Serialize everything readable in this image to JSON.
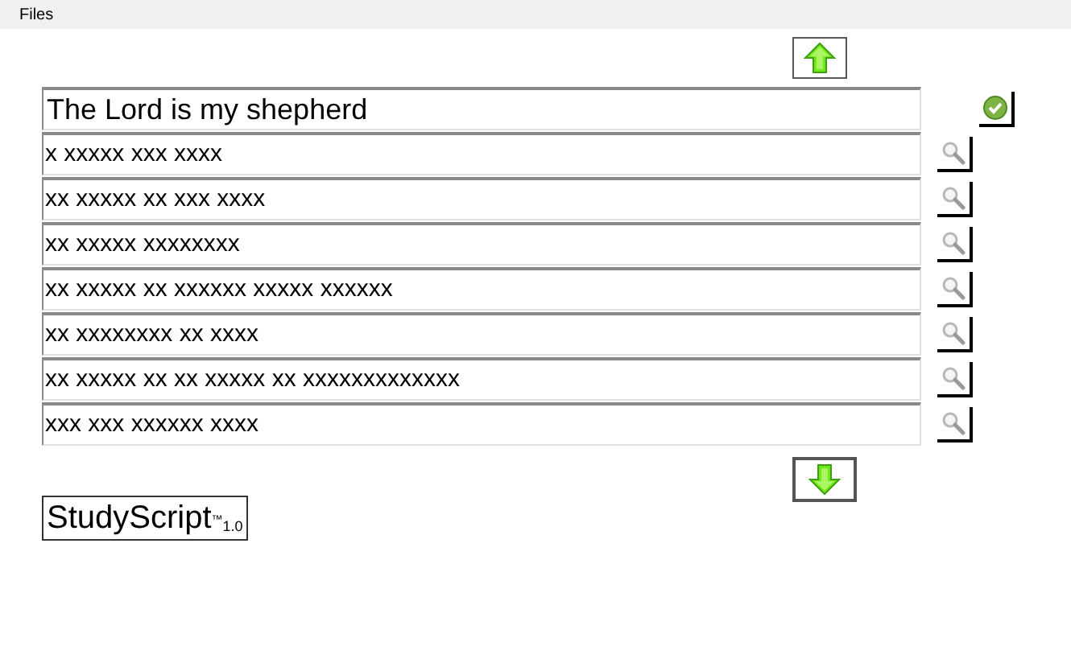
{
  "menu": [
    "Files"
  ],
  "title_field": {
    "value": "The Lord is my shepherd"
  },
  "lines": [
    {
      "value": "x xxxxx xxx xxxx"
    },
    {
      "value": "xx xxxxx xx xxx xxxx"
    },
    {
      "value": "xx xxxxx xxxxxxxx"
    },
    {
      "value": "xx xxxxx xx xxxxxx xxxxx xxxxxx"
    },
    {
      "value": "xx xxxxxxxx xx xxxx"
    },
    {
      "value": "xx xxxxx xx xx xxxxx xx xxxxxxxxxxxxx"
    },
    {
      "value": "xxx xxx xxxxxx xxxx"
    }
  ],
  "logo": "StudyScript$^{™}$$_{1.0}$"
}
